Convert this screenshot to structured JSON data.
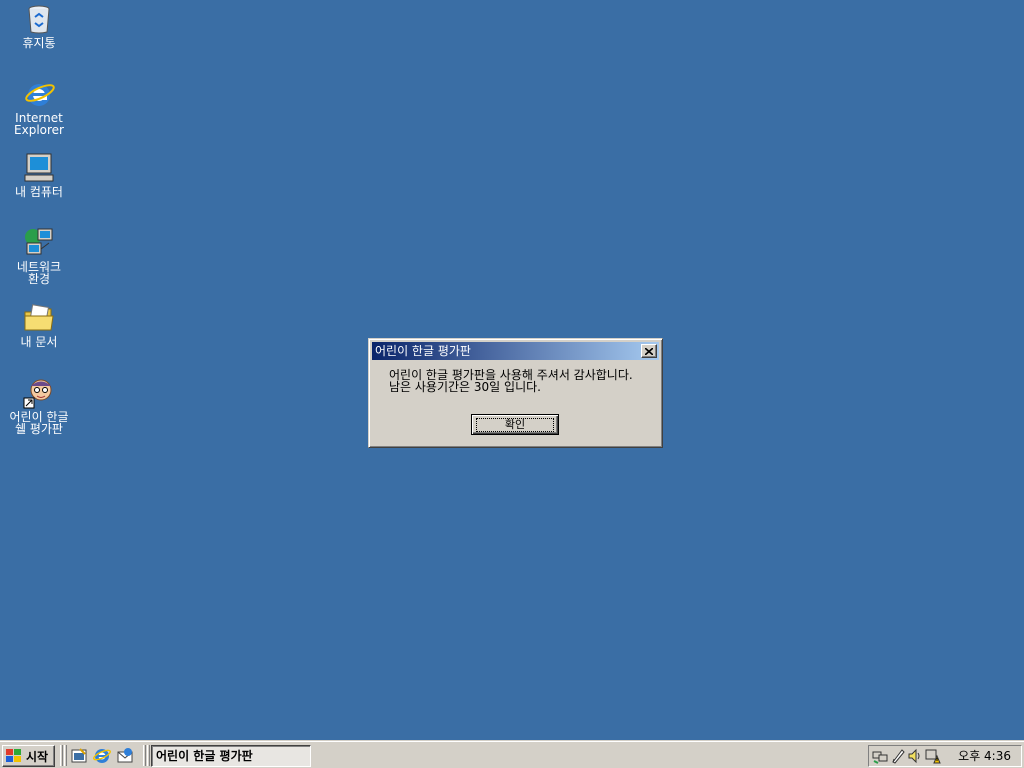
{
  "desktop": {
    "icons": [
      {
        "label": "휴지통",
        "icon": "recycle-bin-icon"
      },
      {
        "label": "Internet\nExplorer",
        "icon": "internet-explorer-icon"
      },
      {
        "label": "내 컴퓨터",
        "icon": "my-computer-icon"
      },
      {
        "label": "네트워크\n환경",
        "icon": "network-neighborhood-icon"
      },
      {
        "label": "내 문서",
        "icon": "my-documents-icon"
      },
      {
        "label": "어린이 한글\n쉘 평가판",
        "icon": "kids-hangul-shortcut-icon"
      }
    ]
  },
  "dialog": {
    "title": "어린이 한글 평가판",
    "line1": "어린이 한글 평가판을 사용해 주셔서 감사합니다.",
    "line2": "남은 사용기간은 30일 입니다.",
    "ok_label": "확인"
  },
  "taskbar": {
    "start_label": "시작",
    "quick_launch": [
      "show-desktop-icon",
      "internet-explorer-icon",
      "outlook-express-icon"
    ],
    "active_task": "어린이 한글 평가판",
    "tray_icons": [
      "network-tray-icon",
      "pen-tray-icon",
      "volume-icon",
      "warning-tray-icon"
    ],
    "clock": "오후 4:36"
  },
  "colors": {
    "desktop": "#3A6EA5",
    "title_start": "#0A246A",
    "title_end": "#A6CAF0",
    "face": "#D4D0C8"
  }
}
